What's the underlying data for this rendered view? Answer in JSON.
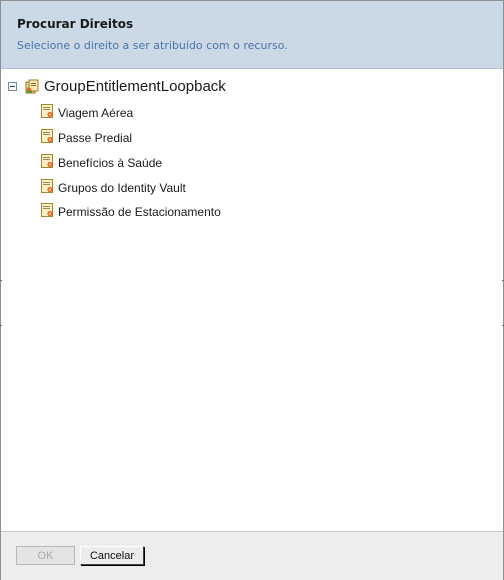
{
  "dialog": {
    "title": "Procurar Direitos",
    "subtitle": "Selecione o direito a ser atribuído com o recurso."
  },
  "tree": {
    "root": {
      "label": "GroupEntitlementLoopback",
      "icon": "entitlement-folder-icon",
      "expanded": true
    },
    "items": [
      {
        "label": "Viagem Aérea",
        "icon": "entitlement-doc-icon"
      },
      {
        "label": "Passe Predial",
        "icon": "entitlement-doc-icon"
      },
      {
        "label": "Benefícios à Saúde",
        "icon": "entitlement-doc-icon"
      },
      {
        "label": "Grupos do Identity Vault",
        "icon": "entitlement-doc-icon"
      },
      {
        "label": "Permissão de Estacionamento",
        "icon": "entitlement-doc-icon"
      }
    ]
  },
  "buttons": {
    "ok": {
      "label": "OK",
      "enabled": false
    },
    "cancel": {
      "label": "Cancelar",
      "enabled": true
    }
  },
  "colors": {
    "header_bg": "#cbd9e7",
    "subtitle_text": "#4a74a8",
    "footer_bg": "#eeedec"
  }
}
